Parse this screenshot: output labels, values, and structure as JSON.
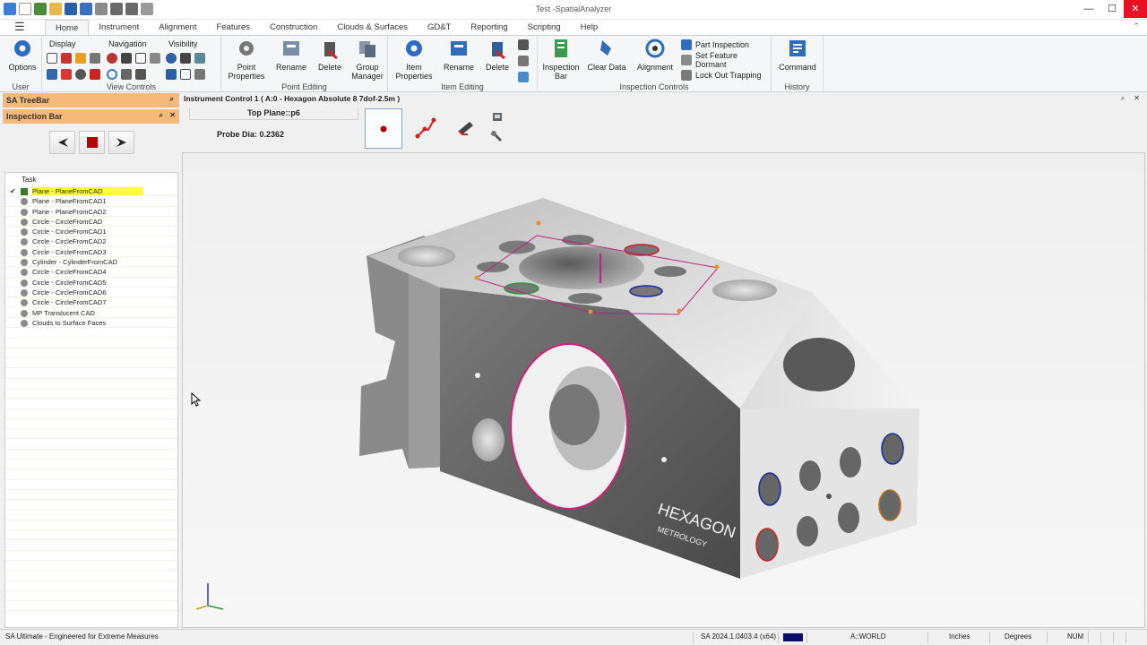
{
  "window": {
    "title": "Test -SpatialAnalyzer",
    "controls": [
      "—",
      "☐",
      "✕"
    ]
  },
  "menu": {
    "tabs": [
      "Home",
      "Instrument",
      "Alignment",
      "Features",
      "Construction",
      "Clouds & Surfaces",
      "GD&T",
      "Reporting",
      "Scripting",
      "Help"
    ],
    "active_tab": "Home"
  },
  "ribbon": {
    "user": {
      "options_label": "Options",
      "group_label": "User"
    },
    "view_controls": {
      "display_label": "Display",
      "navigation_label": "Navigation",
      "visibility_label": "Visibility",
      "group_label": "View Controls"
    },
    "point_editing": {
      "buttons": [
        "Point\nProperties",
        "Rename",
        "Delete",
        "Group\nManager"
      ],
      "group_label": "Point Editing"
    },
    "item_editing": {
      "buttons": [
        "Item\nProperties",
        "Rename",
        "Delete"
      ],
      "group_label": "Item Editing"
    },
    "inspection_controls": {
      "buttons": [
        "Inspection\nBar",
        "Clear Data",
        "Alignment"
      ],
      "list": [
        "Part Inspection",
        "Set Feature Dormant",
        "Lock Out Trapping"
      ],
      "group_label": "Inspection Controls"
    },
    "history": {
      "command_label": "Command",
      "group_label": "History"
    }
  },
  "left": {
    "treebar_title": "SA TreeBar",
    "inspection_bar_title": "Inspection Bar",
    "pin_glyph": "⌕",
    "close_glyph": "✕",
    "task_header": "Task",
    "tasks": [
      {
        "label": "Plane - PlaneFromCAD",
        "current": true,
        "check": "✔"
      },
      {
        "label": "Plane - PlaneFromCAD1"
      },
      {
        "label": "Plane - PlaneFromCAD2"
      },
      {
        "label": "Circle - CircleFromCAD"
      },
      {
        "label": "Circle - CircleFromCAD1"
      },
      {
        "label": "Circle - CircleFromCAD2"
      },
      {
        "label": "Circle - CircleFromCAD3"
      },
      {
        "label": "Cylinder - CylinderFromCAD"
      },
      {
        "label": "Circle - CircleFromCAD4"
      },
      {
        "label": "Circle - CircleFromCAD5"
      },
      {
        "label": "Circle - CircleFromCAD6"
      },
      {
        "label": "Circle - CircleFromCAD7"
      },
      {
        "label": "MP Translucent CAD"
      },
      {
        "label": "Clouds to Surface Faces"
      }
    ]
  },
  "instrument_control": {
    "title": "Instrument Control 1 ( A:0 - Hexagon Absolute 8 7dof-2.5m )",
    "target": "Top Plane::p6",
    "probe": "Probe Dia: 0.2362"
  },
  "viewport": {
    "logo_text": "HEXAGON",
    "logo_sub": "METROLOGY"
  },
  "status": {
    "left_text": "SA Ultimate - Engineered for Extreme Measures",
    "version": "SA 2024.1.0403.4 (x64)",
    "frame": "A::WORLD",
    "units_length": "Inches",
    "units_angle": "Degrees",
    "numlock": "NUM"
  },
  "colors": {
    "panel_header": "#f6b979",
    "current_task": "#ffff33",
    "close_button": "#e81123",
    "accent_blue": "#1f5fa8",
    "feature_magenta": "#d0207a"
  }
}
